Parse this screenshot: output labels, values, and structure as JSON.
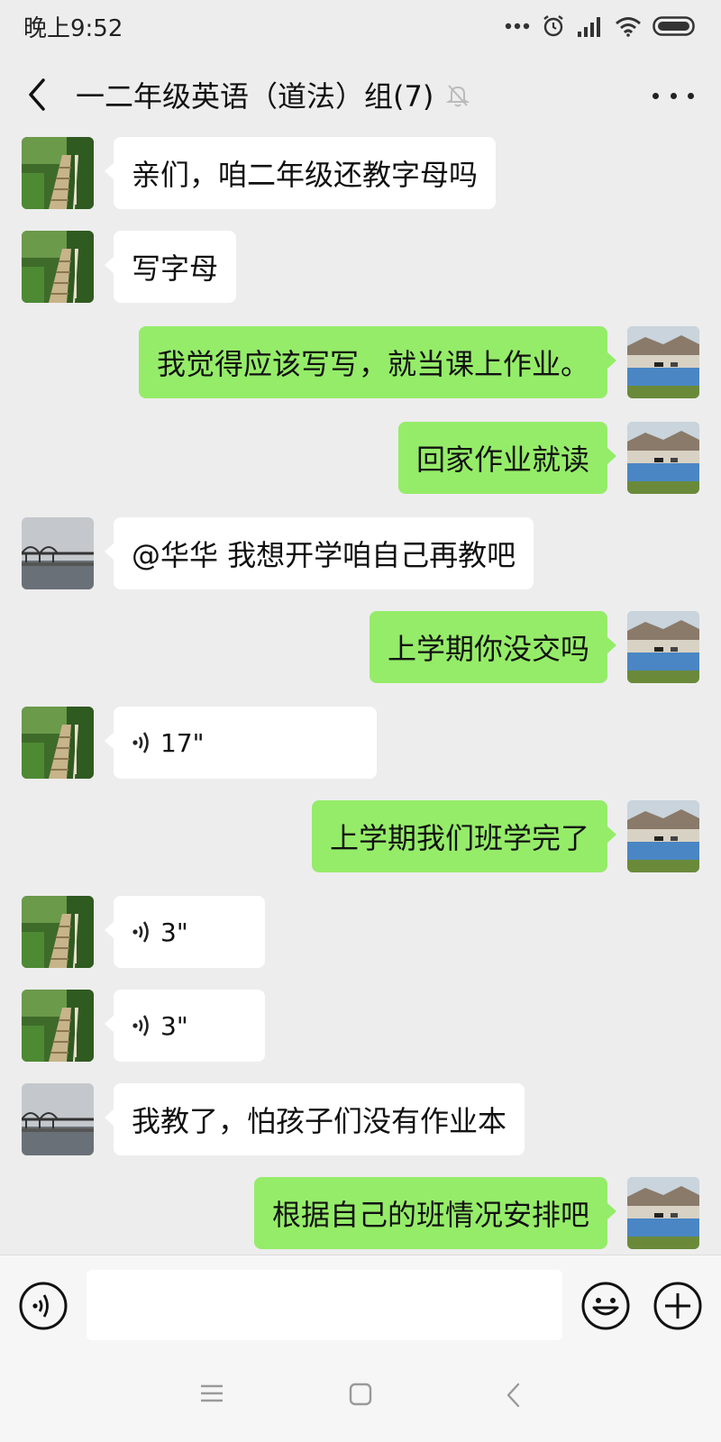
{
  "status_bar": {
    "time": "晚上9:52",
    "icons": [
      "more-dots-icon",
      "alarm-icon",
      "signal-icon",
      "wifi-icon",
      "battery-icon"
    ]
  },
  "header": {
    "back_icon": "chevron-left-icon",
    "title": "一二年级英语（道法）组(7)",
    "mute_icon": "bell-off-icon",
    "more_icon": "more-icon"
  },
  "colors": {
    "background": "#ededed",
    "self_bubble": "#95ec69",
    "other_bubble": "#ffffff"
  },
  "messages": [
    {
      "side": "left",
      "avatar": "forest-stairs",
      "type": "text",
      "text": "亲们，咱二年级还教字母吗"
    },
    {
      "side": "left",
      "avatar": "forest-stairs",
      "type": "text",
      "text": "写字母"
    },
    {
      "side": "right",
      "avatar": "lake-horses",
      "type": "text",
      "text": "我觉得应该写写，就当课上作业。"
    },
    {
      "side": "right",
      "avatar": "lake-horses",
      "type": "text",
      "text": "回家作业就读"
    },
    {
      "side": "left",
      "avatar": "bridge-river",
      "type": "text",
      "text": "@华华  我想开学咱自己再教吧"
    },
    {
      "side": "right",
      "avatar": "lake-horses",
      "type": "text",
      "text": "上学期你没交吗"
    },
    {
      "side": "left",
      "avatar": "forest-stairs",
      "type": "voice",
      "text": "17\""
    },
    {
      "side": "right",
      "avatar": "lake-horses",
      "type": "text",
      "text": "上学期我们班学完了"
    },
    {
      "side": "left",
      "avatar": "forest-stairs",
      "type": "voice",
      "text": "3\""
    },
    {
      "side": "left",
      "avatar": "forest-stairs",
      "type": "voice",
      "text": "3\""
    },
    {
      "side": "left",
      "avatar": "bridge-river",
      "type": "text",
      "text": "我教了，怕孩子们没有作业本"
    },
    {
      "side": "right",
      "avatar": "lake-horses",
      "type": "text",
      "text": "根据自己的班情况安排吧"
    }
  ],
  "input_bar": {
    "voice_icon": "voice-icon",
    "input_value": "",
    "emoji_icon": "emoji-icon",
    "plus_icon": "plus-icon"
  },
  "system_nav": {
    "icons": [
      "menu-icon",
      "home-icon",
      "back-icon"
    ]
  }
}
